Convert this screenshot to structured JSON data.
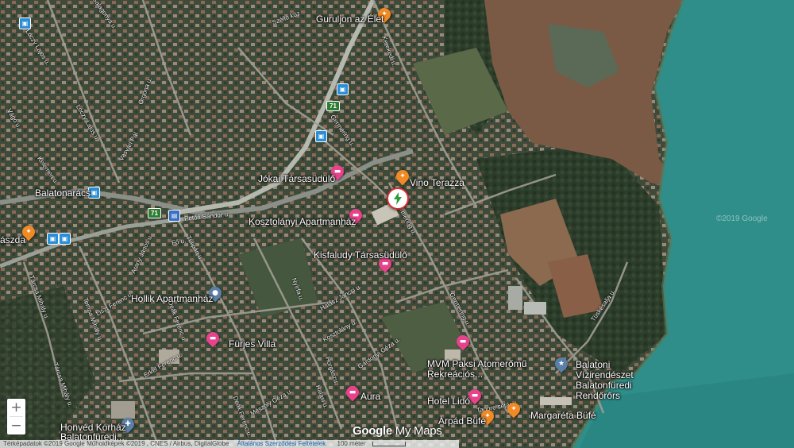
{
  "map": {
    "places": {
      "guruljon": "Guruljon az Élet",
      "jokai": "Jókai Társasüdülő",
      "vino": "Vino Terazza",
      "balatonaracs": "Balatonarács",
      "kosztolanyi": "Kosztolányi Apartmanház",
      "kisfaludy": "Kisfaludy Társasüdülő",
      "hollik": "Hollik Apartmanház",
      "furjes": "Fürjes Villa",
      "mvm": "MVM Paksi Atomerőmű Rekreációs...",
      "vizirendeszet": "Balatoni Vízirendészet Balatonfüredi Rendőrőrs",
      "aura": "Aura",
      "lido": "Hotel Lidó",
      "arpad": "Árpád Büfé",
      "margareta": "Margaréta Büfé",
      "honved": "Honvéd Kórház Balatonfüredi...",
      "pizzeria": "ászda"
    },
    "streets": [
      "Galagonya u.",
      "Lóczy Lajos u.",
      "Lóczy Lajos u.",
      "Orgona u.",
      "Germering u.",
      "Germering u.",
      "Germering u.",
      "Szélló köz",
      "Kerekedi u.",
      "Petőfi Sándor u.",
      "Vasvári Pál",
      "Tárcsa Mihály u.",
      "Liszt Ferenc u.",
      "Erkel Ferenc u.",
      "Mészöly Géza u.",
      "Gárdonyi Géza u.",
      "Halasi u.",
      "Horgászu.",
      "Deák Ferenc u.",
      "Tulipán u.",
      "Tüskésalja u.",
      "Arany János u.",
      "Tárcsa Mihály u.",
      "Kelemen u.",
      "Vágó u.",
      "Halász Jancsi u.",
      "Deák Ferenc u.",
      "Nyírfa u.",
      "Kosztolány u.",
      "Tompa Mihály u.",
      "Fő u.",
      "Tagore sétány"
    ],
    "highway_number": "71",
    "water_watermark": "©2019 Google"
  },
  "controls": {
    "zoom_in": "+",
    "zoom_out": "−"
  },
  "branding": {
    "google": "Google",
    "mymaps": "My Maps"
  },
  "footer": {
    "attribution": "Térképadatok ©2019 Google Műholdképek ©2019 , CNES / Airbus, DigitalGlobe",
    "terms": "Általános Szerződési Feltételek",
    "scale": "100 méter"
  },
  "colors": {
    "water": "#2f8e8a",
    "poi_pink": "#e8428c",
    "poi_orange": "#f08a24",
    "ev_ring": "#d32f2f"
  }
}
